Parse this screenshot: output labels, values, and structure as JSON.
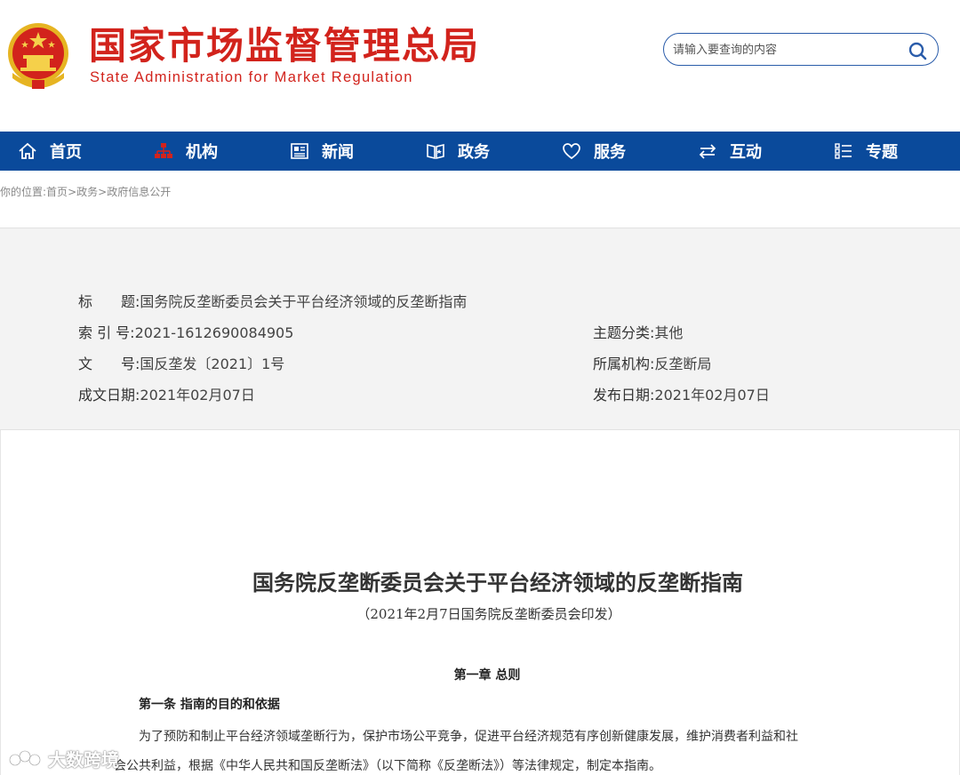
{
  "header": {
    "title_cn": "国家市场监督管理总局",
    "title_en": "State Administration for Market Regulation",
    "search_placeholder": "请输入要查询的内容",
    "emblem_icon": "national-emblem",
    "brand_color": "#d2231c"
  },
  "nav": {
    "color": "#0a4a9b",
    "items": [
      {
        "label": "首页",
        "icon": "home-icon"
      },
      {
        "label": "机构",
        "icon": "org-chart-icon"
      },
      {
        "label": "新闻",
        "icon": "news-icon"
      },
      {
        "label": "政务",
        "icon": "government-affairs-icon"
      },
      {
        "label": "服务",
        "icon": "heart-icon"
      },
      {
        "label": "互动",
        "icon": "exchange-icon"
      },
      {
        "label": "专题",
        "icon": "list-icon"
      }
    ]
  },
  "breadcrumb": {
    "prefix": "你的位置:",
    "items": [
      "首页",
      "政务",
      "政府信息公开"
    ],
    "separator": ">"
  },
  "info": {
    "title_label": "标　　题:",
    "title_value": "国务院反垄断委员会关于平台经济领域的反垄断指南",
    "index_label": "索 引 号:",
    "index_value": "2021-1612690084905",
    "doc_label": "文　　号:",
    "doc_value": "国反垄发〔2021〕1号",
    "created_label": "成文日期:",
    "created_value": "2021年02月07日",
    "topic_label": "主题分类:",
    "topic_value": "其他",
    "org_label": "所属机构:",
    "org_value": "反垄断局",
    "published_label": "发布日期:",
    "published_value": "2021年02月07日"
  },
  "article": {
    "title": "国务院反垄断委员会关于平台经济领域的反垄断指南",
    "subtitle": "（2021年2月7日国务院反垄断委员会印发）",
    "chapter": "第一章  总则",
    "article_head": "第一条  指南的目的和依据",
    "para1": "为了预防和制止平台经济领域垄断行为，保护市场公平竞争，促进平台经济规范有序创新健康发展，维护消费者利益和社",
    "para2": "会公共利益，根据《中华人民共和国反垄断法》（以下简称《反垄断法》）等法律规定，制定本指南。"
  },
  "watermark": {
    "text": "大数跨境",
    "icon": "watermark-logo-icon"
  }
}
